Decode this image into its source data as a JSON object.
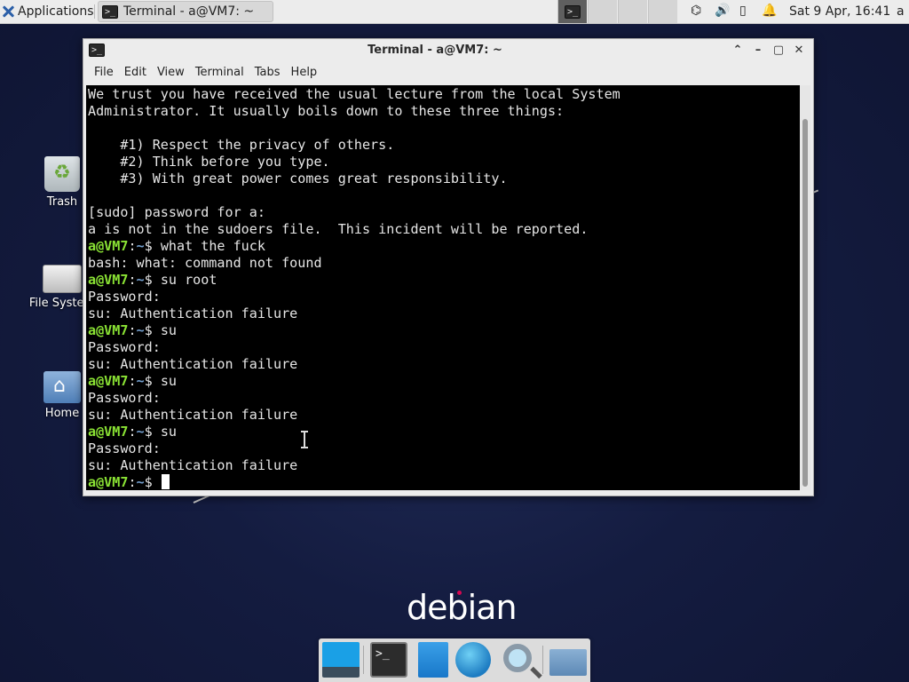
{
  "top_panel": {
    "applications_label": "Applications",
    "task_title": "Terminal - a@VM7: ~",
    "clock": "Sat  9 Apr, 16:41",
    "user": "a"
  },
  "desktop": {
    "icons": [
      {
        "label": "Trash"
      },
      {
        "label": "File System"
      },
      {
        "label": "Home"
      }
    ],
    "wallpaper_text": "debian"
  },
  "terminal": {
    "title": "Terminal - a@VM7: ~",
    "menu": [
      "File",
      "Edit",
      "View",
      "Terminal",
      "Tabs",
      "Help"
    ],
    "prompt_user": "a@VM7",
    "prompt_sep": ":",
    "prompt_path": "~",
    "prompt_end": "$ ",
    "lines": [
      {
        "text": "We trust you have received the usual lecture from the local System"
      },
      {
        "text": "Administrator. It usually boils down to these three things:"
      },
      {
        "text": ""
      },
      {
        "text": "    #1) Respect the privacy of others."
      },
      {
        "text": "    #2) Think before you type."
      },
      {
        "text": "    #3) With great power comes great responsibility."
      },
      {
        "text": ""
      },
      {
        "text": "[sudo] password for a:"
      },
      {
        "text": "a is not in the sudoers file.  This incident will be reported."
      },
      {
        "cmd": "what the fuck"
      },
      {
        "text": "bash: what: command not found"
      },
      {
        "cmd": "su root"
      },
      {
        "text": "Password:"
      },
      {
        "text": "su: Authentication failure"
      },
      {
        "cmd": "su"
      },
      {
        "text": "Password:"
      },
      {
        "text": "su: Authentication failure"
      },
      {
        "cmd": "su"
      },
      {
        "text": "Password:"
      },
      {
        "text": "su: Authentication failure"
      },
      {
        "cmd": "su"
      },
      {
        "text": "Password:"
      },
      {
        "text": "su: Authentication failure"
      },
      {
        "cmd": "",
        "cursor": true
      }
    ]
  },
  "dock": {
    "items": [
      "show-desktop-icon",
      "terminal-icon",
      "file-manager-icon",
      "web-browser-icon",
      "app-finder-icon",
      "folder-icon"
    ]
  }
}
